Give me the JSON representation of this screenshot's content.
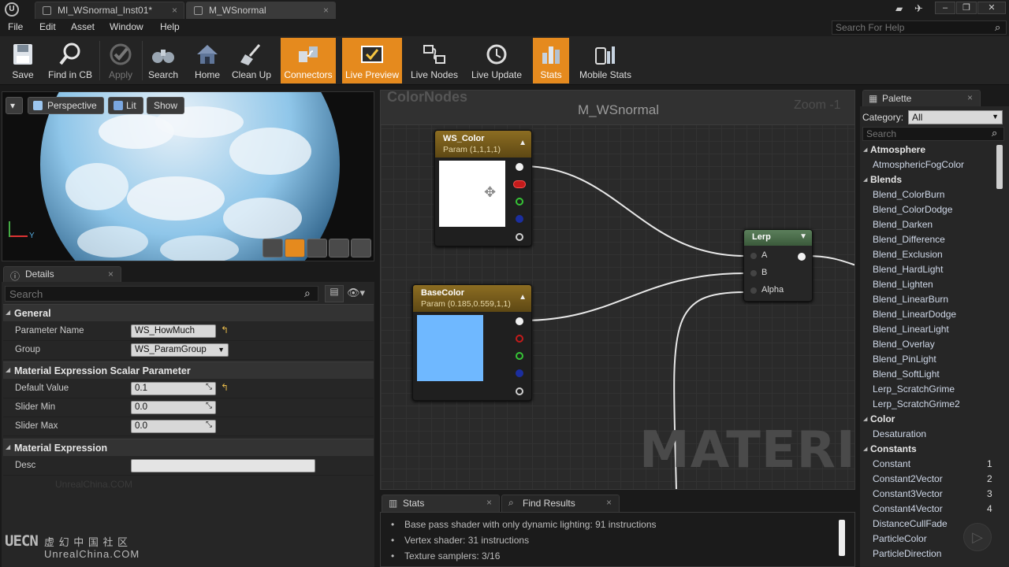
{
  "window": {
    "tabs": [
      {
        "label": "MI_WSnormal_Inst01*",
        "active": false
      },
      {
        "label": "M_WSnormal",
        "active": true
      }
    ]
  },
  "menu": [
    "File",
    "Edit",
    "Asset",
    "Window",
    "Help"
  ],
  "help_search": {
    "placeholder": "Search For Help"
  },
  "toolbar": [
    {
      "label": "Save",
      "icon": "save-icon",
      "active": false
    },
    {
      "label": "Find in CB",
      "icon": "find-in-cb-icon",
      "active": false
    },
    {
      "label": "Apply",
      "icon": "apply-icon",
      "active": false
    },
    {
      "label": "Search",
      "icon": "binoculars-icon",
      "active": false
    },
    {
      "label": "Home",
      "icon": "home-icon",
      "active": false
    },
    {
      "label": "Clean Up",
      "icon": "broom-icon",
      "active": false
    },
    {
      "label": "Connectors",
      "icon": "connectors-icon",
      "active": true
    },
    {
      "label": "Live Preview",
      "icon": "live-preview-icon",
      "active": true
    },
    {
      "label": "Live Nodes",
      "icon": "live-nodes-icon",
      "active": false
    },
    {
      "label": "Live Update",
      "icon": "live-update-icon",
      "active": false
    },
    {
      "label": "Stats",
      "icon": "stats-icon",
      "active": true
    },
    {
      "label": "Mobile Stats",
      "icon": "mobile-stats-icon",
      "active": false
    }
  ],
  "viewport": {
    "perspective": "Perspective",
    "lit": "Lit",
    "show": "Show",
    "axis_y": "Y"
  },
  "details": {
    "tab": "Details",
    "search_placeholder": "Search",
    "sections": [
      {
        "title": "General",
        "rows": [
          {
            "label": "Parameter Name",
            "value": "WS_HowMuch"
          },
          {
            "label": "Group",
            "value": "WS_ParamGroup"
          }
        ]
      },
      {
        "title": "Material Expression Scalar Parameter",
        "rows": [
          {
            "label": "Default Value",
            "value": "0.1"
          },
          {
            "label": "Slider Min",
            "value": "0.0"
          },
          {
            "label": "Slider Max",
            "value": "0.0"
          }
        ]
      },
      {
        "title": "Material Expression",
        "rows": [
          {
            "label": "Desc",
            "value": ""
          }
        ]
      }
    ],
    "watermark": "UnrealChina.COM"
  },
  "graph": {
    "section_title": "ColorNodes",
    "material_title": "M_WSnormal",
    "zoom": "Zoom -1",
    "watermark": "MATERIAL",
    "nodes": {
      "ws_color": {
        "title": "WS_Color",
        "sub": "Param (1,1,1,1)",
        "preview_color": "#ffffff"
      },
      "base_color": {
        "title": "BaseColor",
        "sub": "Param (0.185,0.559,1,1)",
        "preview_color": "#6fb8ff"
      },
      "lerp": {
        "title": "Lerp",
        "pins": [
          "A",
          "B",
          "Alpha"
        ]
      }
    }
  },
  "palette": {
    "tab": "Palette",
    "category_label": "Category:",
    "category_value": "All",
    "search_placeholder": "Search",
    "groups": [
      {
        "name": "Atmosphere",
        "items": [
          {
            "label": "AtmosphericFogColor",
            "key": ""
          }
        ]
      },
      {
        "name": "Blends",
        "items": [
          {
            "label": "Blend_ColorBurn",
            "key": ""
          },
          {
            "label": "Blend_ColorDodge",
            "key": ""
          },
          {
            "label": "Blend_Darken",
            "key": ""
          },
          {
            "label": "Blend_Difference",
            "key": ""
          },
          {
            "label": "Blend_Exclusion",
            "key": ""
          },
          {
            "label": "Blend_HardLight",
            "key": ""
          },
          {
            "label": "Blend_Lighten",
            "key": ""
          },
          {
            "label": "Blend_LinearBurn",
            "key": ""
          },
          {
            "label": "Blend_LinearDodge",
            "key": ""
          },
          {
            "label": "Blend_LinearLight",
            "key": ""
          },
          {
            "label": "Blend_Overlay",
            "key": ""
          },
          {
            "label": "Blend_PinLight",
            "key": ""
          },
          {
            "label": "Blend_SoftLight",
            "key": ""
          },
          {
            "label": "Lerp_ScratchGrime",
            "key": ""
          },
          {
            "label": "Lerp_ScratchGrime2",
            "key": ""
          }
        ]
      },
      {
        "name": "Color",
        "items": [
          {
            "label": "Desaturation",
            "key": ""
          }
        ]
      },
      {
        "name": "Constants",
        "items": [
          {
            "label": "Constant",
            "key": "1"
          },
          {
            "label": "Constant2Vector",
            "key": "2"
          },
          {
            "label": "Constant3Vector",
            "key": "3"
          },
          {
            "label": "Constant4Vector",
            "key": "4"
          },
          {
            "label": "DistanceCullFade",
            "key": ""
          },
          {
            "label": "ParticleColor",
            "key": ""
          },
          {
            "label": "ParticleDirection",
            "key": ""
          }
        ]
      }
    ]
  },
  "bottom_tabs": {
    "stats": "Stats",
    "find_results": "Find Results"
  },
  "stats": [
    "Base pass shader with only dynamic lighting: 91 instructions",
    "Vertex shader: 31 instructions",
    "Texture samplers: 3/16"
  ],
  "logo": {
    "mark": "UECN",
    "cn": "虚 幻 中 国 社 区",
    "en": "UnrealChina.COM"
  },
  "colors": {
    "accent": "#e58a1e",
    "node_header": "#8c6d22"
  }
}
